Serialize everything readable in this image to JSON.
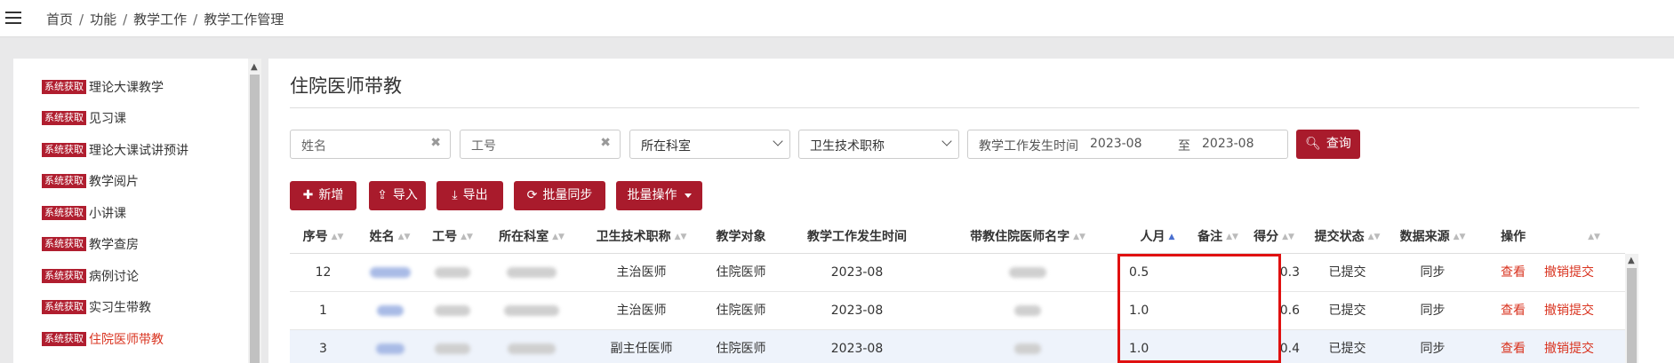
{
  "breadcrumb": [
    "首页",
    "功能",
    "教学工作",
    "教学工作管理"
  ],
  "sidebar": {
    "badge": "系统获取",
    "items": [
      {
        "label": "理论大课教学",
        "active": false
      },
      {
        "label": "见习课",
        "active": false
      },
      {
        "label": "理论大课试讲预讲",
        "active": false
      },
      {
        "label": "教学阅片",
        "active": false
      },
      {
        "label": "小讲课",
        "active": false
      },
      {
        "label": "教学查房",
        "active": false
      },
      {
        "label": "病例讨论",
        "active": false
      },
      {
        "label": "实习生带教",
        "active": false
      },
      {
        "label": "住院医师带教",
        "active": true
      }
    ]
  },
  "page": {
    "title": "住院医师带教"
  },
  "filters": {
    "name_placeholder": "姓名",
    "id_placeholder": "工号",
    "dept_placeholder": "所在科室",
    "title_placeholder": "卫生技术职称",
    "date_label": "教学工作发生时间",
    "date_from": "2023-08",
    "date_to_sep": "至",
    "date_to": "2023-08",
    "search_label": "查询"
  },
  "toolbar": {
    "add": "新增",
    "import": "导入",
    "export": "导出",
    "sync": "批量同步",
    "batch": "批量操作"
  },
  "table": {
    "headers": [
      "序号",
      "姓名",
      "工号",
      "所在科室",
      "卫生技术职称",
      "教学对象",
      "教学工作发生时间",
      "带教住院医师名字",
      "人月",
      "备注",
      "得分",
      "提交状态",
      "数据来源",
      "操作"
    ],
    "rows": [
      {
        "seq": "12",
        "title": "主治医师",
        "target": "住院医师",
        "date": "2023-08",
        "months": "0.5",
        "remark": "",
        "score": "0.3",
        "status": "已提交",
        "source": "同步",
        "view": "查看",
        "revoke": "撤销提交"
      },
      {
        "seq": "1",
        "title": "主治医师",
        "target": "住院医师",
        "date": "2023-08",
        "months": "1.0",
        "remark": "",
        "score": "0.6",
        "status": "已提交",
        "source": "同步",
        "view": "查看",
        "revoke": "撤销提交"
      },
      {
        "seq": "3",
        "title": "副主任医师",
        "target": "住院医师",
        "date": "2023-08",
        "months": "1.0",
        "remark": "",
        "score": "0.4",
        "status": "已提交",
        "source": "同步",
        "view": "查看",
        "revoke": "撤销提交"
      }
    ]
  },
  "colors": {
    "brand": "#a91b2c",
    "active_link": "#d9331f",
    "highlight_box": "#e01010"
  }
}
